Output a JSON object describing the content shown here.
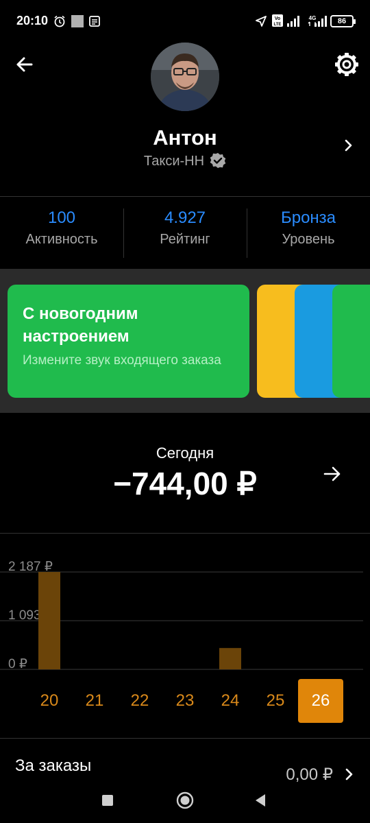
{
  "status_bar": {
    "time": "20:10",
    "battery": "86",
    "icons": [
      "alarm-icon",
      "notification-icon",
      "message-icon",
      "location-icon",
      "volte-icon",
      "signal-icon",
      "4g-icon",
      "signal-icon"
    ]
  },
  "header": {
    "back_icon": "back-arrow-icon",
    "settings_icon": "gear-icon"
  },
  "profile": {
    "name": "Антон",
    "park": "Такси-НН",
    "verified_icon": "verified-badge-icon"
  },
  "stats": [
    {
      "value": "100",
      "label": "Активность"
    },
    {
      "value": "4.927",
      "label": "Рейтинг"
    },
    {
      "value": "Бронза",
      "label": "Уровень"
    }
  ],
  "promo": {
    "title": "С новогодним настроением",
    "subtitle": "Измените звук входящего заказа"
  },
  "today": {
    "label": "Сегодня",
    "amount": "−744,00 ₽"
  },
  "chart_data": {
    "type": "bar",
    "categories": [
      "20",
      "21",
      "22",
      "23",
      "24",
      "25",
      "26"
    ],
    "values": [
      2187,
      0,
      0,
      0,
      480,
      0,
      0
    ],
    "selected": "26",
    "ylim": [
      0,
      2187
    ],
    "y_ticks": [
      "2 187 ₽",
      "1 093 ₽",
      "0 ₽"
    ],
    "y_tick_values": [
      2187,
      1093,
      0
    ],
    "grid": true
  },
  "orders": {
    "label": "За заказы",
    "value": "0,00 ₽"
  },
  "colors": {
    "accent_blue": "#2a8cff",
    "promo_green": "#20bb4d",
    "bar_brown": "#6b4409",
    "day_orange": "#d9891a",
    "selected_orange": "#e0860a"
  }
}
